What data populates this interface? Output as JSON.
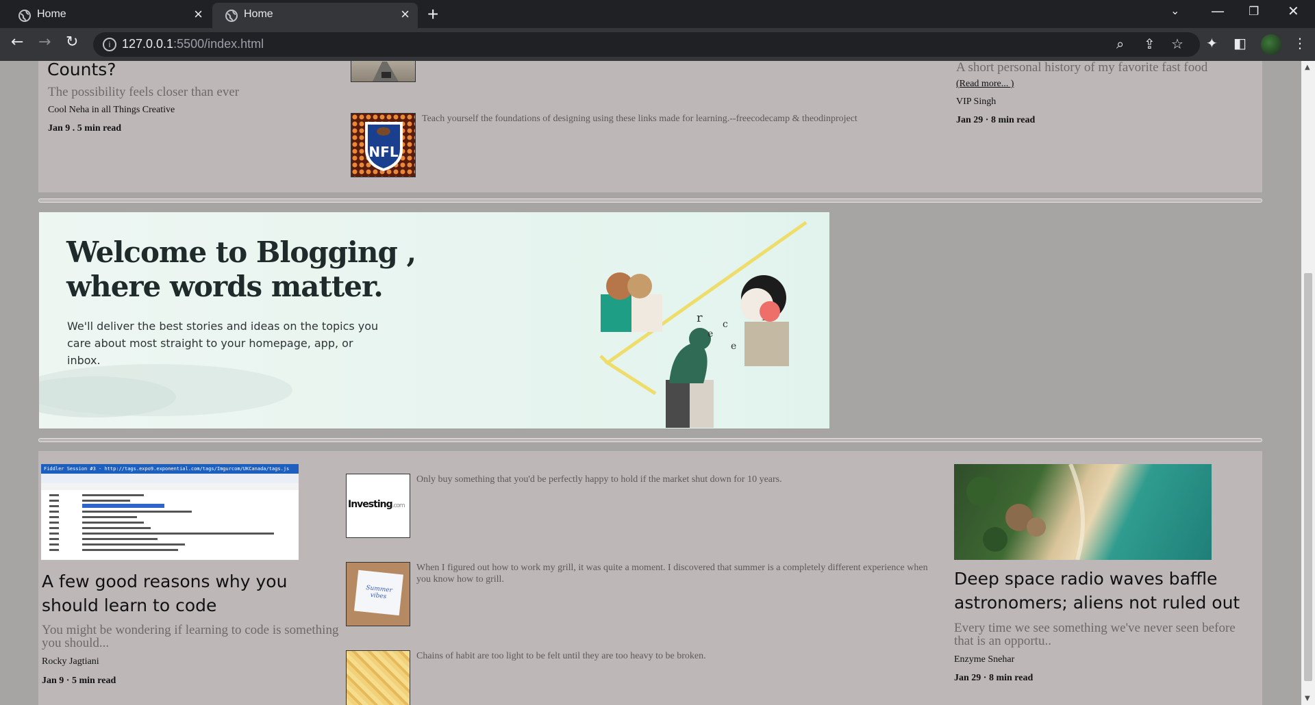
{
  "browser": {
    "tabs": [
      {
        "label": "Home"
      },
      {
        "label": "Home"
      }
    ],
    "url_host": "127.0.0.1",
    "url_path": ":5500/index.html"
  },
  "top_section": {
    "left_card": {
      "title": "Counts?",
      "subtitle": "The possibility feels closer than ever",
      "author": "Cool Neha in all Things Creative",
      "date": "Jan 9 . 5 min read"
    },
    "middle_items": [
      {
        "snippet": "Teach yourself the foundations of designing using these links made for learning.--freecodecamp & theodinproject",
        "image": "nfl-logo"
      }
    ],
    "right_card": {
      "subtitle": "A short personal history of my favorite fast food",
      "read_more": "(Read more... )",
      "author": "VIP Singh",
      "date": "Jan 29 · 8 min read"
    }
  },
  "banner": {
    "heading_line1": "Welcome to Blogging ,",
    "heading_line2": "where words matter.",
    "text": "We'll deliver the best stories and ideas on the topics you care about most straight to your homepage, app, or inbox."
  },
  "bottom_section": {
    "left_card": {
      "title": "A few good reasons why you should learn to code",
      "subtitle": "You might be wondering if learning to code is something you should...",
      "author": "Rocky Jagtiani",
      "date": "Jan 9 · 5 min read",
      "image_caption": "Fiddler Session #3 - http://tags.expo9.exponential.com/tags/Imgurcom/UKCanada/tags.js"
    },
    "middle_items": [
      {
        "snippet": "Only buy something that you'd be perfectly happy to hold if the market shut down for 10 years.",
        "image_text": "Investing",
        "image_suffix": ".com"
      },
      {
        "snippet": "When I figured out how to work my grill, it was quite a moment. I discovered that summer is a completely different experience when you know how to grill.",
        "image_text": "Summer vibes"
      },
      {
        "snippet": "Chains of habit are too light to be felt until they are too heavy to be broken."
      }
    ],
    "right_card": {
      "title": "Deep space radio waves baffle astronomers; aliens not ruled out",
      "subtitle": "Every time we see something we've never seen before that is an opportu..",
      "author": "Enzyme Snehar",
      "date": "Jan 29 · 8 min read"
    }
  }
}
